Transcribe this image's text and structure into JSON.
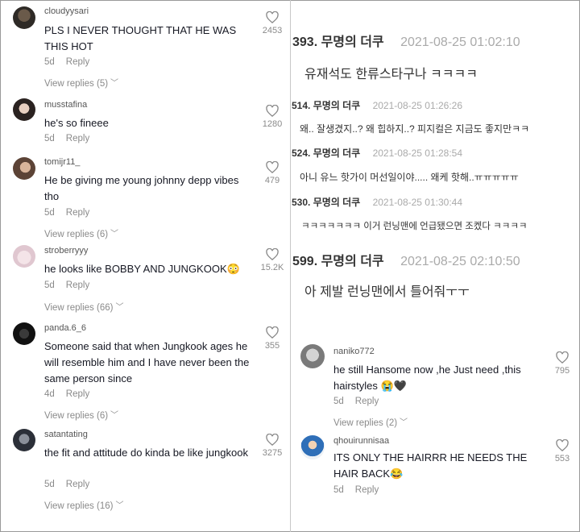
{
  "left_comments": [
    {
      "username": "cloudyysari",
      "text": "PLS I NEVER THOUGHT THAT HE WAS THIS HOT",
      "age": "5d",
      "reply": "Reply",
      "view_replies": "View replies (5)",
      "likes": "2453"
    },
    {
      "username": "musstafina",
      "text": "he's so fineee",
      "age": "5d",
      "reply": "Reply",
      "likes": "1280"
    },
    {
      "username": "tomijr11_",
      "text": "He be giving me young johnny depp vibes tho",
      "age": "5d",
      "reply": "Reply",
      "view_replies": "View replies (6)",
      "likes": "479"
    },
    {
      "username": "stroberryyy",
      "text": "he looks like BOBBY AND JUNGKOOK😳",
      "age": "5d",
      "reply": "Reply",
      "view_replies": "View replies (66)",
      "likes": "15.2K"
    },
    {
      "username": "panda.6_6",
      "text": "Someone said that when Jungkook ages he will resemble him and I have never been the same person since",
      "age": "4d",
      "reply": "Reply",
      "view_replies": "View replies (6)",
      "likes": "355"
    },
    {
      "username": "satantating",
      "text": "the fit and attitude do kinda be like jungkook",
      "age": "5d",
      "reply": "Reply",
      "view_replies": "View replies (16)",
      "likes": "3275"
    }
  ],
  "forum_posts": [
    {
      "number": "393. 무명의 더쿠",
      "date": "2021-08-25 01:02:10",
      "body": "유재석도 한류스타구나 ㅋㅋㅋㅋ"
    },
    {
      "number": "514. 무명의 더쿠",
      "date": "2021-08-25 01:26:26",
      "body": "왜.. 잘생겼지..? 왜 힙하지..? 피지컬은 지금도 좋지만ㅋㅋ"
    },
    {
      "number": "524. 무명의 더쿠",
      "date": "2021-08-25 01:28:54",
      "body": "아니 유느 핫가이 머선일이야..... 왜케 핫해..ㅠㅠㅠㅠㅠ"
    },
    {
      "number": "530. 무명의 더쿠",
      "date": "2021-08-25 01:30:44",
      "body": "ㅋㅋㅋㅋㅋㅋㅋ 이거 런닝맨에 언급됐으면 조켔다 ㅋㅋㅋㅋ"
    },
    {
      "number": "599. 무명의 더쿠",
      "date": "2021-08-25 02:10:50",
      "body": "아 제발 런닝맨에서 틀어줘ㅜㅜ"
    }
  ],
  "right_comments": [
    {
      "username": "naniko772",
      "text": "he still Hansome now ,he Just need ,this hairstyles 😭🖤",
      "age": "5d",
      "reply": "Reply",
      "view_replies": "View replies (2)",
      "likes": "795"
    },
    {
      "username": "qhouirunnisaa",
      "text": "ITS ONLY THE HAIRRR HE NEEDS THE HAIR BACK😂",
      "age": "5d",
      "reply": "Reply",
      "likes": "553"
    }
  ]
}
